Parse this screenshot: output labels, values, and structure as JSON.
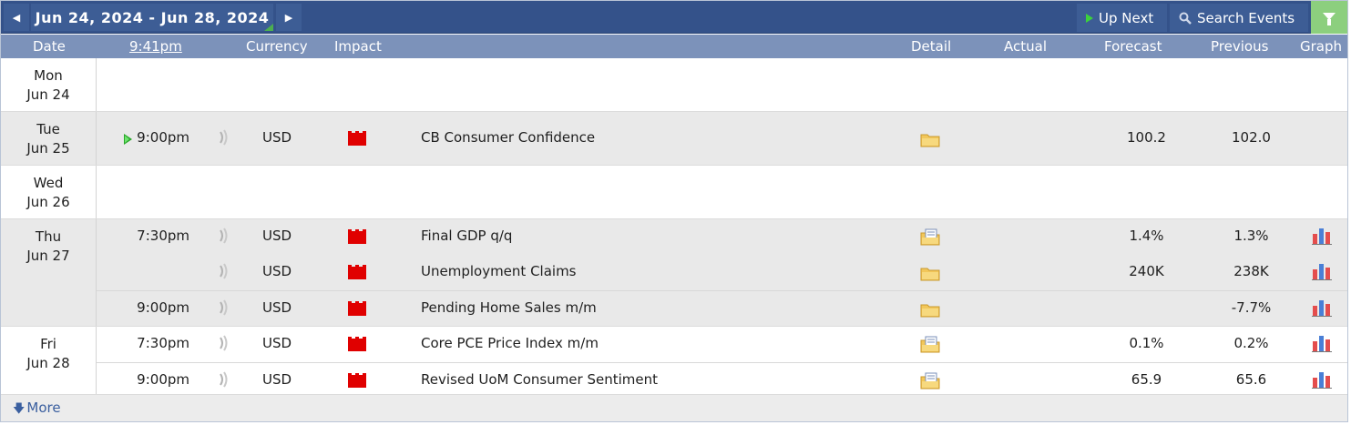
{
  "nav": {
    "prev_icon": "caret-left",
    "next_icon": "caret-right",
    "date_range": "Jun 24, 2024 - Jun 28, 2024",
    "up_next_label": "Up Next",
    "search_label": "Search Events",
    "filter_icon": "funnel"
  },
  "header": {
    "date": "Date",
    "time": "9:41pm",
    "currency": "Currency",
    "impact": "Impact",
    "detail": "Detail",
    "actual": "Actual",
    "forecast": "Forecast",
    "previous": "Previous",
    "graph": "Graph"
  },
  "days": [
    {
      "day": "Mon",
      "date": "Jun 24",
      "shade": "white",
      "events": []
    },
    {
      "day": "Tue",
      "date": "Jun 25",
      "shade": "gray",
      "events": [
        {
          "time": "9:00pm",
          "next": true,
          "currency": "USD",
          "impact": "high",
          "title": "CB Consumer Confidence",
          "detail": "folder",
          "forecast": "100.2",
          "previous": "102.0",
          "graph": false
        }
      ]
    },
    {
      "day": "Wed",
      "date": "Jun 26",
      "shade": "white",
      "events": []
    },
    {
      "day": "Thu",
      "date": "Jun 27",
      "shade": "gray",
      "events": [
        {
          "time": "7:30pm",
          "next": false,
          "currency": "USD",
          "impact": "high",
          "title": "Final GDP q/q",
          "detail": "folder-doc",
          "forecast": "1.4%",
          "previous": "1.3%",
          "graph": true
        },
        {
          "time": "",
          "next": false,
          "currency": "USD",
          "impact": "high",
          "title": "Unemployment Claims",
          "detail": "folder",
          "forecast": "240K",
          "previous": "238K",
          "graph": true
        },
        {
          "time": "9:00pm",
          "next": false,
          "currency": "USD",
          "impact": "high",
          "title": "Pending Home Sales m/m",
          "detail": "folder",
          "forecast": "",
          "previous": "-7.7%",
          "graph": true
        }
      ]
    },
    {
      "day": "Fri",
      "date": "Jun 28",
      "shade": "white",
      "events": [
        {
          "time": "7:30pm",
          "next": false,
          "currency": "USD",
          "impact": "high",
          "title": "Core PCE Price Index m/m",
          "detail": "folder-doc",
          "forecast": "0.1%",
          "previous": "0.2%",
          "graph": true
        },
        {
          "time": "9:00pm",
          "next": false,
          "currency": "USD",
          "impact": "high",
          "title": "Revised UoM Consumer Sentiment",
          "detail": "folder-doc",
          "forecast": "65.9",
          "previous": "65.6",
          "graph": true
        }
      ]
    }
  ],
  "colors": {
    "topbar": "#34528a",
    "header": "#7c92ba",
    "filter": "#8ccf7e",
    "impact_high": "#e00000",
    "link": "#3a5f9f"
  },
  "more_label": "More"
}
